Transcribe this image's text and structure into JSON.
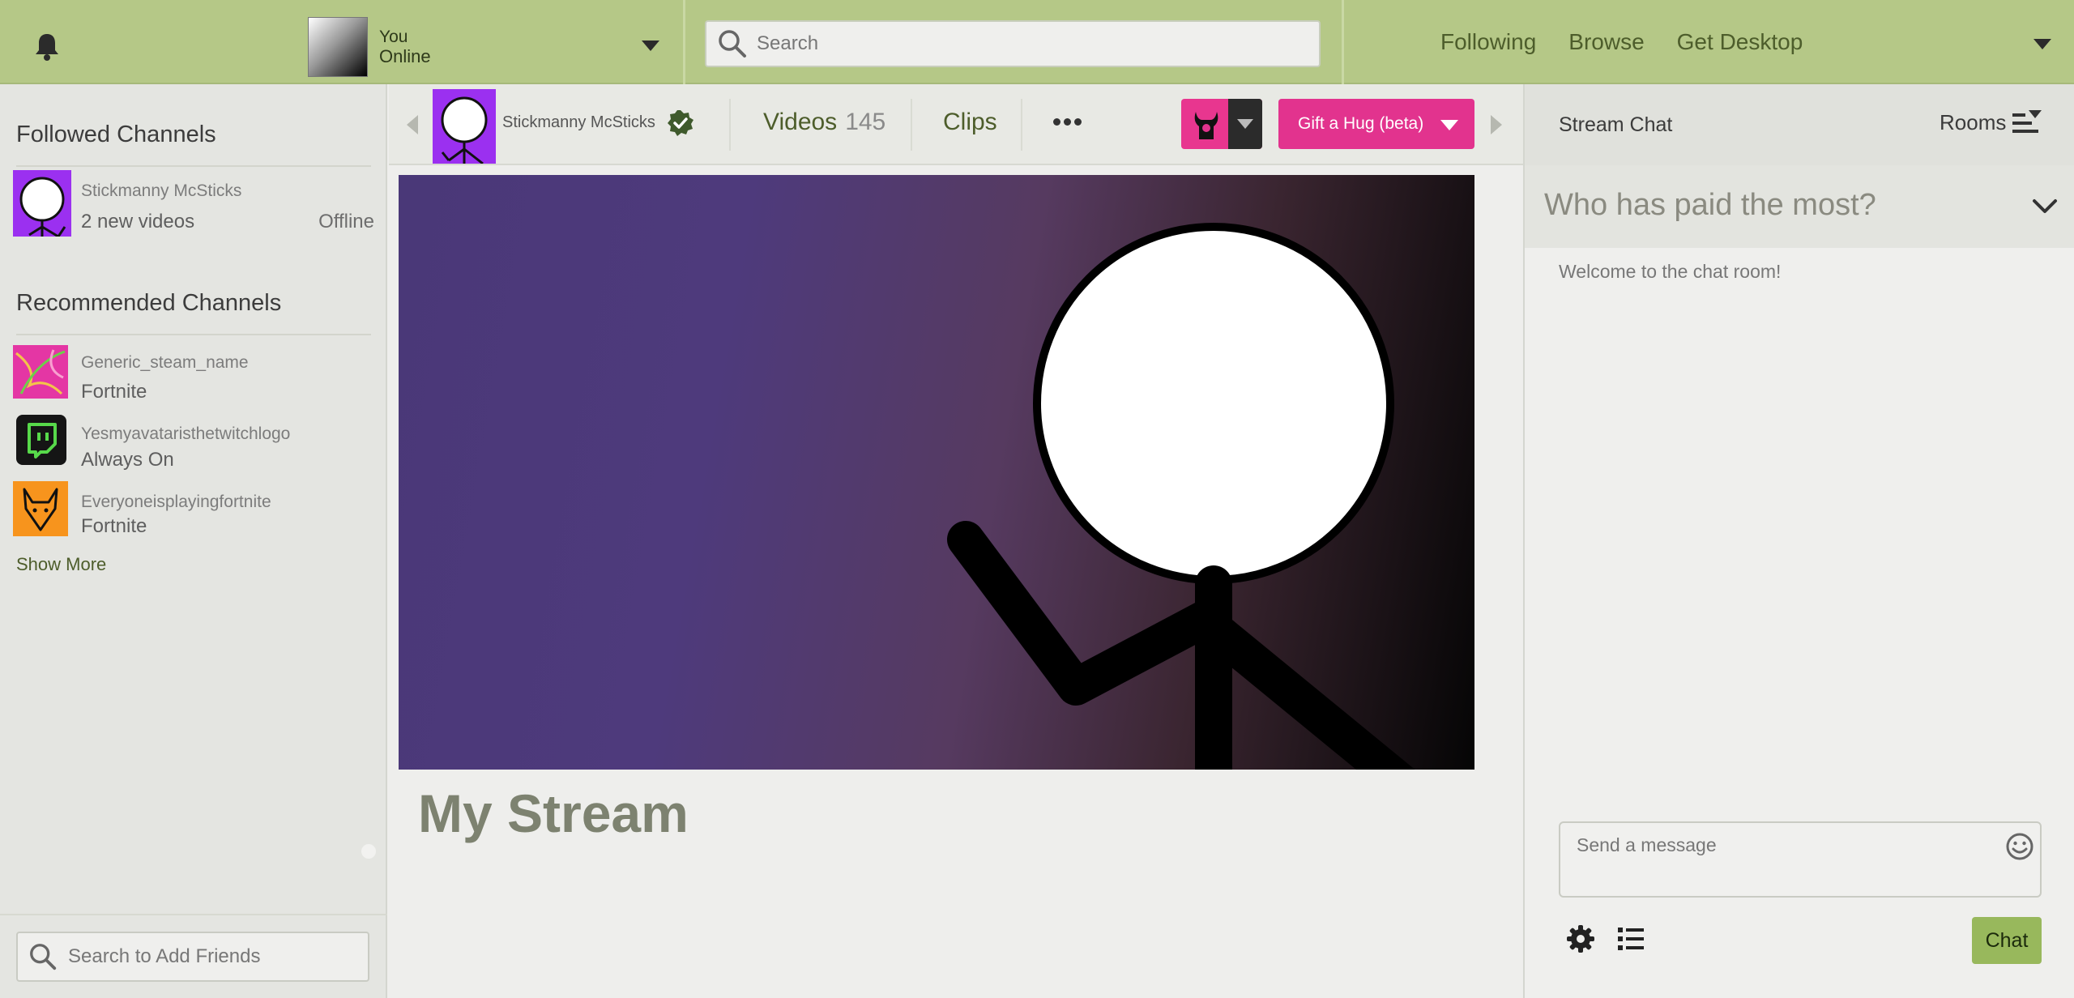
{
  "header": {
    "user": {
      "name": "You",
      "status": "Online"
    },
    "search_placeholder": "Search",
    "nav": [
      "Following",
      "Browse",
      "Get Desktop"
    ]
  },
  "sidebar": {
    "followed_heading": "Followed Channels",
    "followed": [
      {
        "name": "Stickmanny McSticks",
        "sub": "2 new videos",
        "status": "Offline",
        "avatar": "stickman-avatar"
      }
    ],
    "recommended_heading": "Recommended Channels",
    "recommended": [
      {
        "name": "Generic_steam_name",
        "sub": "Fortnite",
        "avatar": "pink-abstract-avatar"
      },
      {
        "name": "Yesmyavataristhetwitchlogo",
        "sub": "Always On",
        "avatar": "twitch-logo-avatar"
      },
      {
        "name": "Everyoneisplayingfortnite",
        "sub": "Fortnite",
        "avatar": "fox-avatar"
      }
    ],
    "show_more": "Show More",
    "friend_search_placeholder": "Search to Add Friends"
  },
  "channel_bar": {
    "name": "Stickmanny McSticks",
    "videos_label": "Videos",
    "videos_count": "145",
    "clips_label": "Clips",
    "gift_label": "Gift a Hug (beta)"
  },
  "stream": {
    "title": "My Stream"
  },
  "chat": {
    "title": "Stream Chat",
    "rooms_label": "Rooms",
    "pinned": "Who has paid the most?",
    "welcome": "Welcome to the chat room!",
    "input_placeholder": "Send a message",
    "send_label": "Chat"
  },
  "colors": {
    "topbar": "#b5c887",
    "accent_text": "#4d5d2b",
    "gift_button": "#e2338e",
    "chat_button": "#98b85c",
    "channel_avatar": "#9b30f0"
  }
}
